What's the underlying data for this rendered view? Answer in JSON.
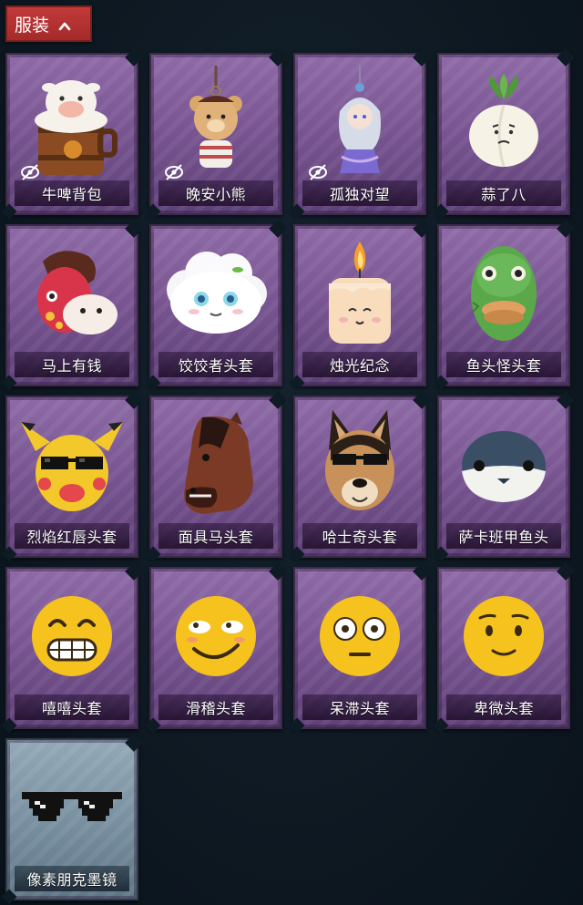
{
  "section": {
    "title": "服装",
    "toggle_icon": "chevron-up-icon",
    "color": "#b03030"
  },
  "items": [
    {
      "label": "牛啤背包",
      "icon": "cow-beer-backpack-icon",
      "hidden": true,
      "theme": "purple"
    },
    {
      "label": "晚安小熊",
      "icon": "teddy-bear-keychain-icon",
      "hidden": true,
      "theme": "purple"
    },
    {
      "label": "孤独对望",
      "icon": "fairy-figure-keychain-icon",
      "hidden": true,
      "theme": "purple"
    },
    {
      "label": "蒜了八",
      "icon": "garlic-mascot-icon",
      "hidden": false,
      "theme": "purple"
    },
    {
      "label": "马上有钱",
      "icon": "red-horse-head-icon",
      "hidden": false,
      "theme": "purple"
    },
    {
      "label": "饺饺者头套",
      "icon": "dumpling-head-icon",
      "hidden": false,
      "theme": "purple"
    },
    {
      "label": "烛光纪念",
      "icon": "candle-head-icon",
      "hidden": false,
      "theme": "purple"
    },
    {
      "label": "鱼头怪头套",
      "icon": "fish-head-mask-icon",
      "hidden": false,
      "theme": "purple"
    },
    {
      "label": "烈焰红唇头套",
      "icon": "yellow-pikachu-mask-icon",
      "hidden": false,
      "theme": "purple"
    },
    {
      "label": "面具马头套",
      "icon": "horse-mask-icon",
      "hidden": false,
      "theme": "purple"
    },
    {
      "label": "哈士奇头套",
      "icon": "husky-mask-icon",
      "hidden": false,
      "theme": "purple"
    },
    {
      "label": "萨卡班甲鱼头",
      "icon": "sacabambaspis-head-icon",
      "hidden": false,
      "theme": "purple"
    },
    {
      "label": "嘻嘻头套",
      "icon": "grinning-emoji-icon",
      "hidden": false,
      "theme": "purple"
    },
    {
      "label": "滑稽头套",
      "icon": "smirk-emoji-icon",
      "hidden": false,
      "theme": "purple"
    },
    {
      "label": "呆滞头套",
      "icon": "stunned-emoji-icon",
      "hidden": false,
      "theme": "purple"
    },
    {
      "label": "卑微头套",
      "icon": "pleading-emoji-icon",
      "hidden": false,
      "theme": "purple"
    },
    {
      "label": "像素朋克墨镜",
      "icon": "pixel-sunglasses-icon",
      "hidden": false,
      "theme": "blue"
    }
  ],
  "hidden_icon": "eye-slash-icon"
}
